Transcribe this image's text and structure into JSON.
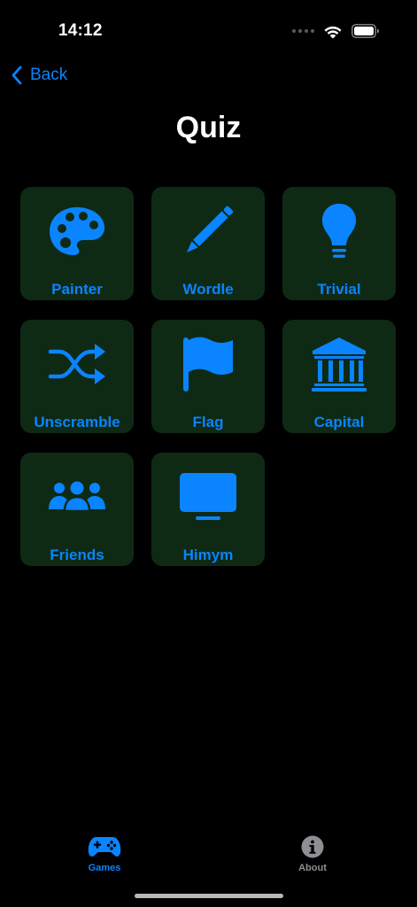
{
  "status_bar": {
    "time": "14:12"
  },
  "nav": {
    "back_label": "Back",
    "title": "Quiz"
  },
  "tiles": [
    {
      "label": "Painter",
      "icon": "palette-icon"
    },
    {
      "label": "Wordle",
      "icon": "pencil-icon"
    },
    {
      "label": "Trivial",
      "icon": "lightbulb-icon"
    },
    {
      "label": "Unscramble",
      "icon": "shuffle-icon"
    },
    {
      "label": "Flag",
      "icon": "flag-icon"
    },
    {
      "label": "Capital",
      "icon": "bank-icon"
    },
    {
      "label": "Friends",
      "icon": "people-icon"
    },
    {
      "label": "Himym",
      "icon": "tv-icon"
    }
  ],
  "tab_bar": {
    "items": [
      {
        "label": "Games",
        "icon": "gamecontroller-icon",
        "selected": true
      },
      {
        "label": "About",
        "icon": "info-icon",
        "selected": false
      }
    ]
  },
  "colors": {
    "accent": "#0a84ff",
    "tile_background": "#0e2a15",
    "background": "#000000",
    "inactive_tab": "#8e8e93"
  }
}
